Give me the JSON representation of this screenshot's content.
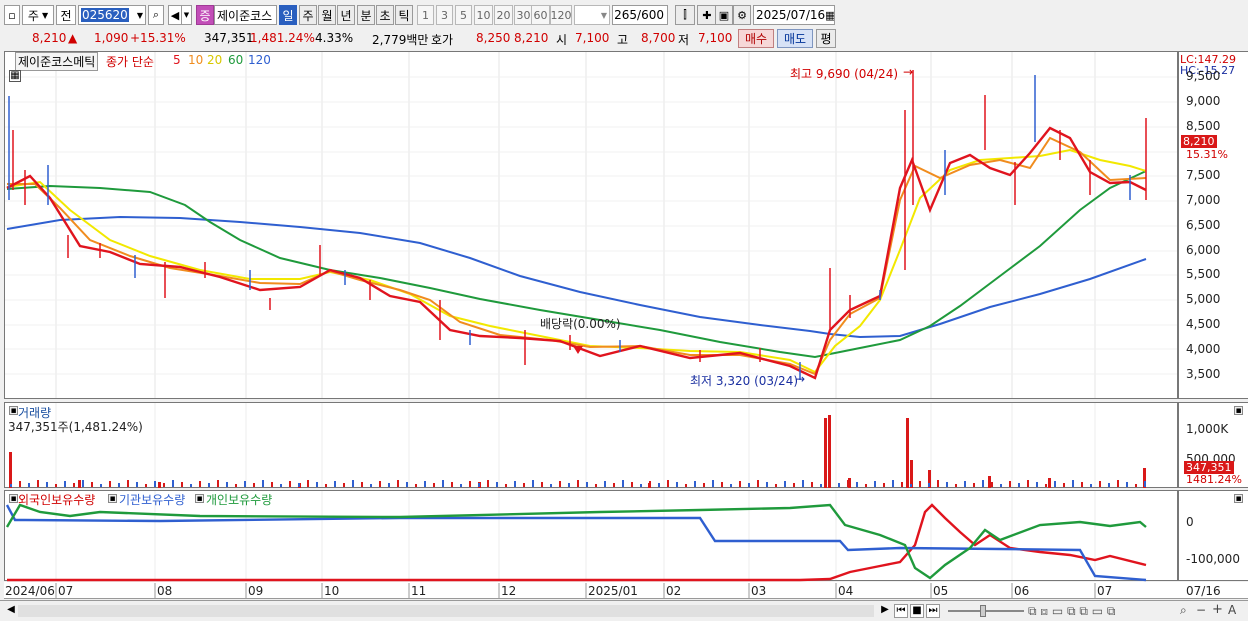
{
  "toolbar": {
    "period_type": "주",
    "compare": "전",
    "code": "025620",
    "stock_name": "제이준코스",
    "stock_badge": "증",
    "periods": [
      "일",
      "주",
      "월",
      "년",
      "분",
      "초",
      "틱"
    ],
    "intervals": [
      "1",
      "3",
      "5",
      "10",
      "20",
      "30",
      "60",
      "120"
    ],
    "count": "265",
    "max_count": "/600",
    "date": "2025/07/16"
  },
  "info": {
    "price": "8,210",
    "up_arrow": "▲",
    "change": "1,090",
    "change_pct": "+15.31%",
    "volume": "347,351",
    "volume_pct": "1,481.24%",
    "turnover": "4.33%",
    "amount": "2,779백만",
    "quote_label": "호가",
    "ask": "8,250",
    "bid": "8,210",
    "open_label": "시",
    "open": "7,100",
    "high_label": "고",
    "high": "8,700",
    "low_label": "저",
    "low": "7,100",
    "buy_btn": "매수",
    "sell_btn": "매도",
    "eval_btn": "평"
  },
  "price_pane": {
    "name_box": "제이준코스메틱",
    "legend_prefix": "종가 단순",
    "ma_labels": [
      "5",
      "10",
      "20",
      "60",
      "120"
    ],
    "ma_colors": [
      "#e0141e",
      "#f08c1e",
      "#f2e800",
      "#1f9a3c",
      "#2f5fd0"
    ],
    "lc_label": "LC:147.29",
    "hc_label": "HC:-15.27",
    "cur_price_label": "8,210",
    "cur_pct_label": "15.31%",
    "high_annot": "최고 9,690 (04/24)",
    "low_annot": "최저 3,320 (03/24)",
    "div_annot": "배당락(0.00%)",
    "y_ticks": [
      "9,500",
      "9,000",
      "8,500",
      "8,000",
      "7,500",
      "7,000",
      "6,500",
      "6,000",
      "5,500",
      "5,000",
      "4,500",
      "4,000",
      "3,500"
    ]
  },
  "volume_pane": {
    "title": "거래량",
    "subtitle": "347,351주(1,481.24%)",
    "y_ticks": [
      "1,000K",
      "500,000"
    ],
    "cur_label": "347,351",
    "cur_pct": "1481.24%"
  },
  "investor_pane": {
    "legend": [
      "외국인보유수량",
      "기관보유수량",
      "개인보유수량"
    ],
    "colors": [
      "#e0141e",
      "#2f5fd0",
      "#1f9a3c"
    ],
    "y_ticks": [
      "0",
      "-100,000"
    ]
  },
  "x_axis": {
    "labels": [
      "2024/06",
      "07",
      "08",
      "09",
      "10",
      "11",
      "12",
      "2025/01",
      "02",
      "03",
      "04",
      "05",
      "06",
      "07"
    ],
    "right_label": "07/16"
  }
}
